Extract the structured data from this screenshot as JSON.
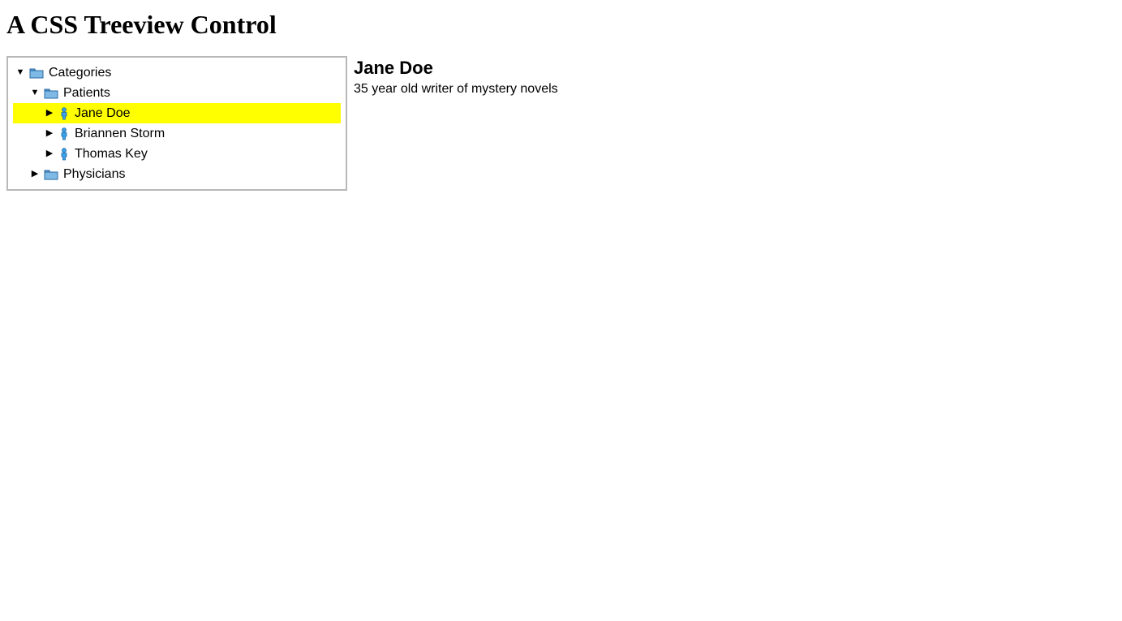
{
  "page": {
    "title": "A CSS Treeview Control"
  },
  "tree": {
    "categories": {
      "label": "Categories",
      "patients": {
        "label": "Patients",
        "items": [
          {
            "label": "Jane Doe"
          },
          {
            "label": "Briannen Storm"
          },
          {
            "label": "Thomas Key"
          }
        ]
      },
      "physicians": {
        "label": "Physicians"
      }
    }
  },
  "detail": {
    "title": "Jane Doe",
    "description": "35 year old writer of mystery novels"
  }
}
